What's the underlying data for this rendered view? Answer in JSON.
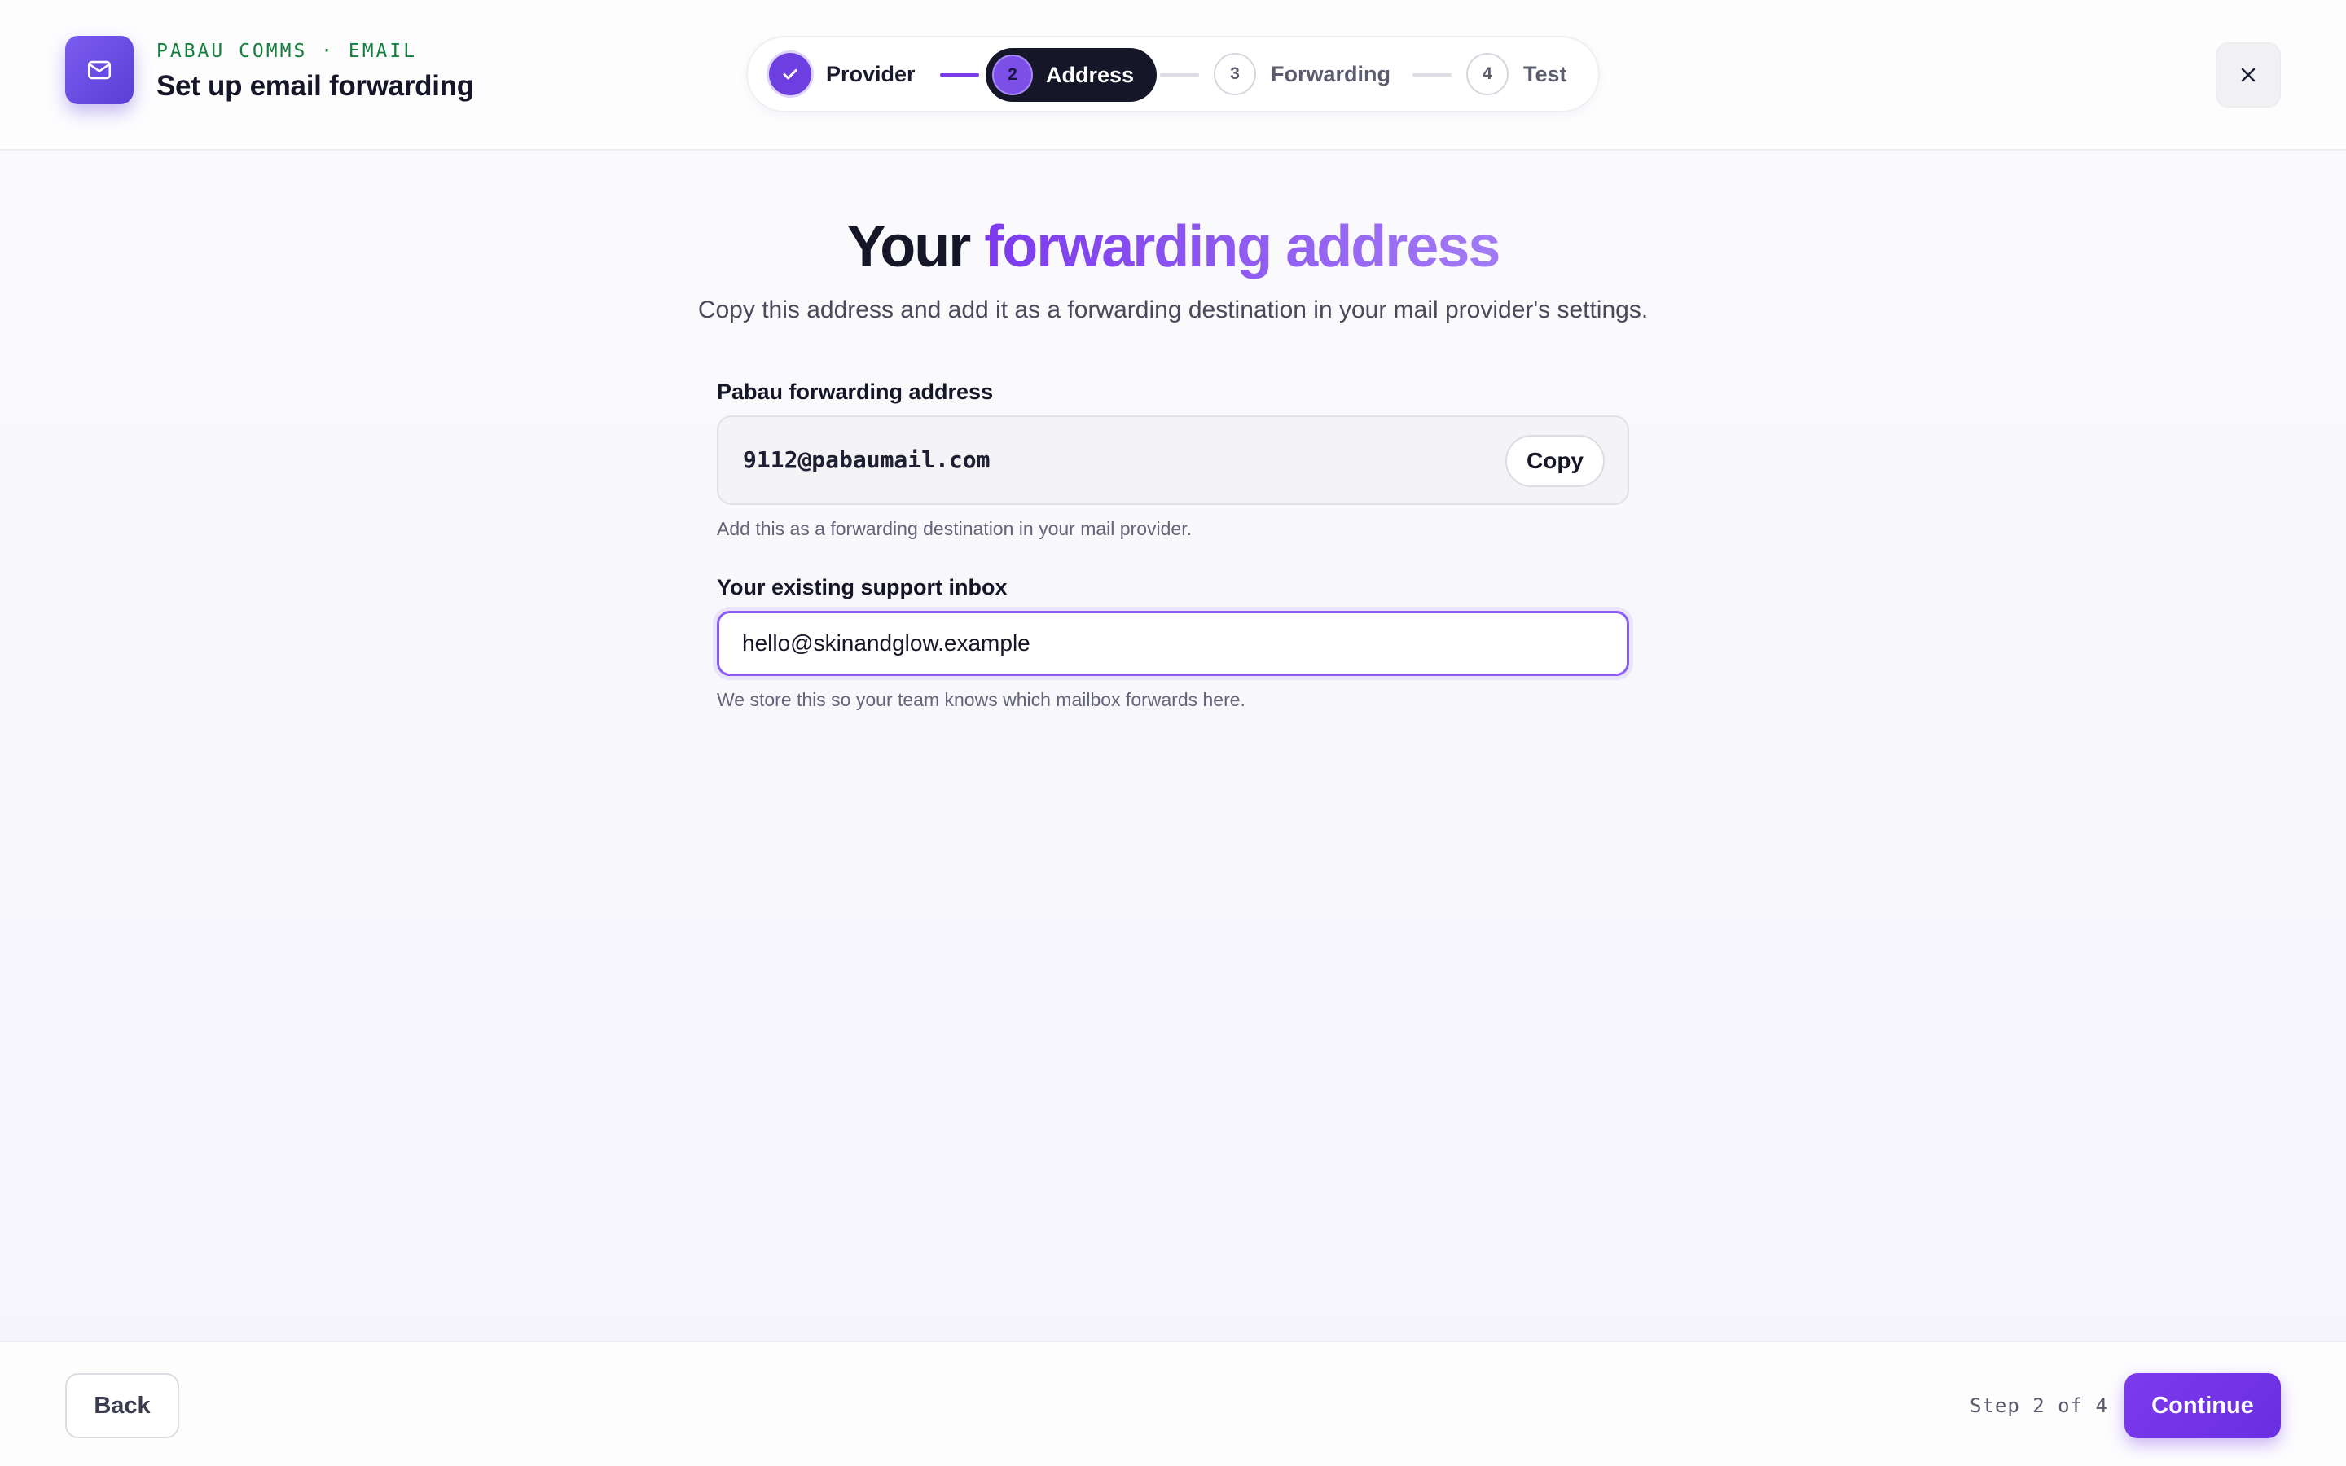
{
  "header": {
    "eyebrow": "PABAU COMMS · EMAIL",
    "title": "Set up email forwarding",
    "app_icon": "mail-icon"
  },
  "stepper": {
    "steps": [
      {
        "number": "1",
        "label": "Provider",
        "state": "done"
      },
      {
        "number": "2",
        "label": "Address",
        "state": "active"
      },
      {
        "number": "3",
        "label": "Forwarding",
        "state": "pending"
      },
      {
        "number": "4",
        "label": "Test",
        "state": "pending"
      }
    ]
  },
  "main": {
    "headline_plain": "Your",
    "headline_accent": "forwarding address",
    "subtitle": "Copy this address and add it as a forwarding destination in your mail provider's settings.",
    "forwarding": {
      "label": "Pabau forwarding address",
      "value": "9112@pabaumail.com",
      "copy_label": "Copy",
      "helper": "Add this as a forwarding destination in your mail provider."
    },
    "inbox": {
      "label": "Your existing support inbox",
      "value": "hello@skinandglow.example",
      "helper": "We store this so your team knows which mailbox forwards here."
    }
  },
  "footer": {
    "back_label": "Back",
    "step_count": "Step 2 of 4",
    "continue_label": "Continue"
  },
  "colors": {
    "accent": "#7c3aed",
    "accent_light": "#a27bf5",
    "dark": "#161629",
    "eyebrow_green": "#15803d"
  }
}
